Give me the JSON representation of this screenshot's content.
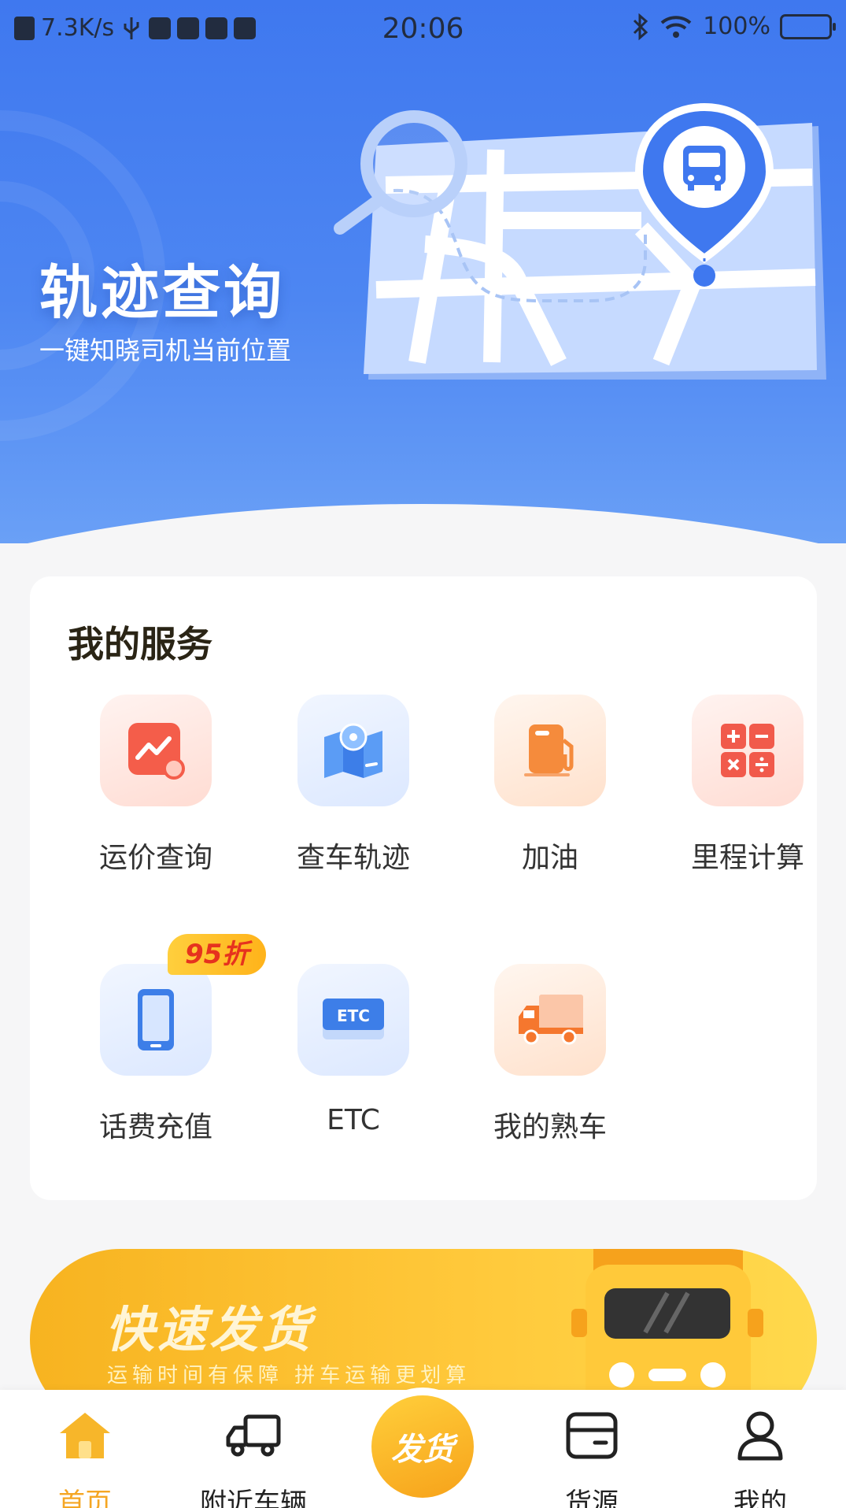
{
  "status_bar": {
    "net_speed": "7.3K/s",
    "time": "20:06",
    "battery": "100%"
  },
  "hero": {
    "title": "轨迹查询",
    "subtitle": "一键知晓司机当前位置"
  },
  "services": {
    "title": "我的服务",
    "items": [
      {
        "label": "运价查询",
        "icon": "price-chart-icon"
      },
      {
        "label": "查车轨迹",
        "icon": "map-track-icon"
      },
      {
        "label": "加油",
        "icon": "fuel-pump-icon"
      },
      {
        "label": "里程计算",
        "icon": "calculator-icon"
      },
      {
        "label": "话费充值",
        "icon": "phone-icon",
        "badge": "95折"
      },
      {
        "label": "ETC",
        "icon": "etc-card-icon",
        "card_text": "ETC"
      },
      {
        "label": "我的熟车",
        "icon": "truck-icon"
      }
    ]
  },
  "banner": {
    "title": "快速发货",
    "subtitle": "运输时间有保障  拼车运输更划算"
  },
  "tabbar": {
    "items": [
      {
        "label": "首页",
        "icon": "home-icon",
        "active": true
      },
      {
        "label": "附近车辆",
        "icon": "truck-outline-icon"
      },
      {
        "label": "货源",
        "icon": "cargo-box-icon"
      },
      {
        "label": "我的",
        "icon": "user-icon"
      }
    ],
    "publish_label": "发货"
  },
  "colors": {
    "hero_blue": "#3f78ef",
    "accent_yellow": "#f5a623",
    "badge_text": "#e6321e"
  }
}
